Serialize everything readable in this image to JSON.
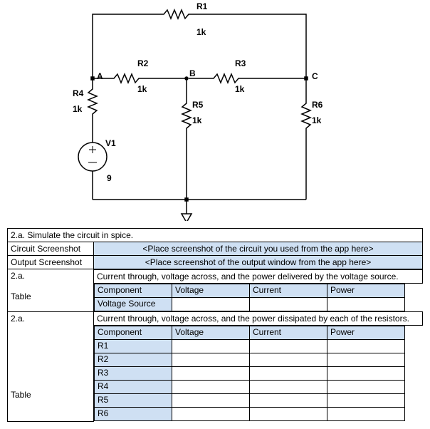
{
  "circuit": {
    "R1": {
      "name": "R1",
      "value": "1k"
    },
    "R2": {
      "name": "R2",
      "value": "1k"
    },
    "R3": {
      "name": "R3",
      "value": "1k"
    },
    "R4": {
      "name": "R4",
      "value": "1k"
    },
    "R5": {
      "name": "R5",
      "value": "1k"
    },
    "R6": {
      "name": "R6",
      "value": "1k"
    },
    "V1": {
      "name": "V1",
      "value": "9"
    },
    "nodes": {
      "A": "A",
      "B": "B",
      "C": "C"
    }
  },
  "prompt": "2.a. Simulate the circuit in spice.",
  "rows": {
    "circuitScreenshot": {
      "label": "Circuit Screenshot",
      "placeholder": "<Place screenshot of the circuit you used from the app  here>"
    },
    "outputScreenshot": {
      "label": "Output Screenshot",
      "placeholder": "<Place screenshot of the output window from the app here>"
    },
    "section1": {
      "num": "2.a.",
      "label": "Table",
      "desc": "Current through, voltage across, and the power delivered by the voltage source."
    },
    "section2": {
      "num": "2.a.",
      "label": "Table",
      "desc": "Current through, voltage across, and the power dissipated by each of the resistors."
    }
  },
  "tableHeaders": {
    "c1": "Component",
    "c2": "Voltage",
    "c3": "Current",
    "c4": "Power"
  },
  "table1": {
    "r1": "Voltage Source"
  },
  "table2": {
    "r1": "R1",
    "r2": "R2",
    "r3": "R3",
    "r4": "R4",
    "r5": "R5",
    "r6": "R6"
  }
}
